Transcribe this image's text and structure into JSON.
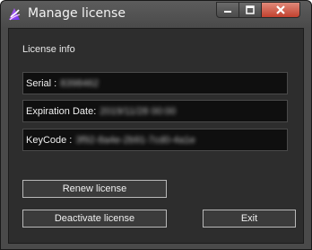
{
  "window": {
    "title": "Manage license",
    "controls": {
      "minimize_icon": "minimize-icon",
      "maximize_icon": "maximize-icon",
      "close_icon": "close-icon"
    }
  },
  "license": {
    "section_label": "License info",
    "serial_label": "Serial :",
    "serial_value": "8398462",
    "expiration_label": "Expiration Date:",
    "expiration_value": "2019/11/28 00:00",
    "keycode_label": "KeyCode :",
    "keycode_value": "3f92-8a4e-2b91-7cd0-4a1e"
  },
  "buttons": {
    "renew": "Renew license",
    "deactivate": "Deactivate license",
    "exit": "Exit"
  },
  "colors": {
    "window_frame": "#4a4a4a",
    "client_bg": "#2d2d2d",
    "field_bg": "#0f0f0f",
    "close_button": "#c2412f"
  }
}
